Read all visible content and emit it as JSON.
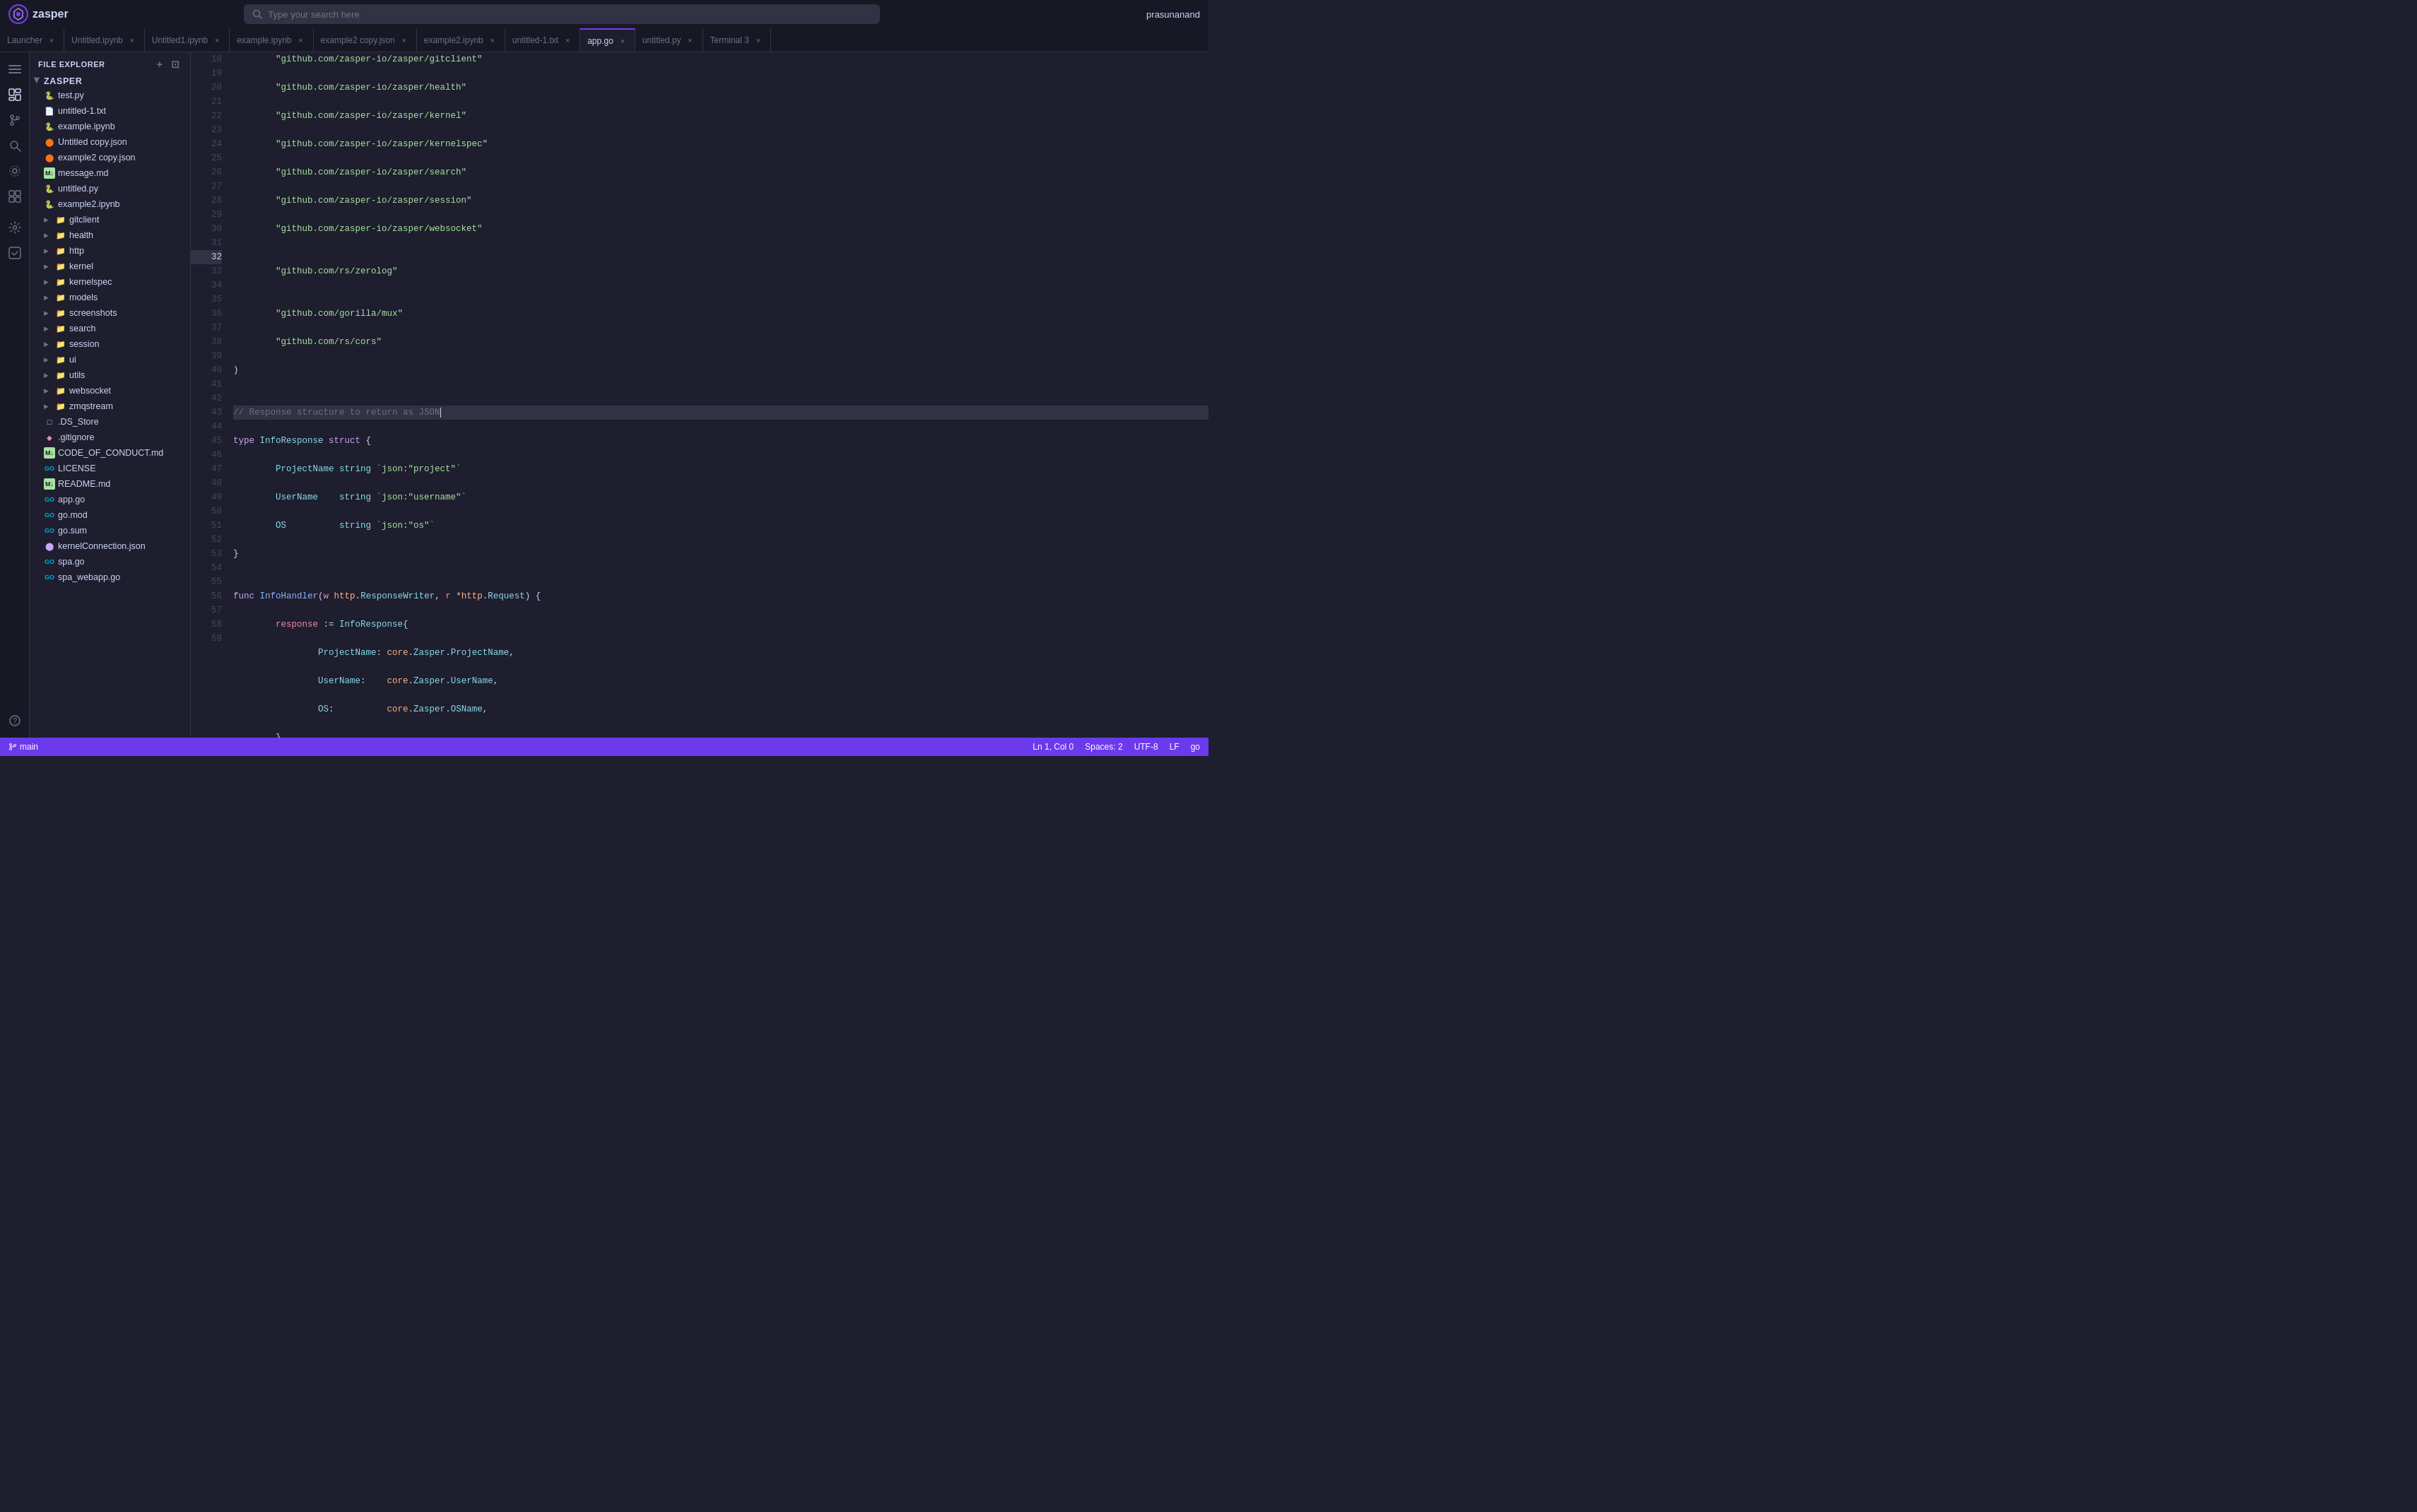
{
  "app": {
    "name": "zasper",
    "logo_alt": "Zasper Logo"
  },
  "topbar": {
    "search_placeholder": "Type your search here",
    "username": "prasunanand"
  },
  "tabs": [
    {
      "label": "Launcher",
      "active": false,
      "closeable": true
    },
    {
      "label": "Untitled.ipynb",
      "active": false,
      "closeable": true
    },
    {
      "label": "Untitled1.ipynb",
      "active": false,
      "closeable": true
    },
    {
      "label": "example.ipynb",
      "active": false,
      "closeable": true
    },
    {
      "label": "example2 copy.json",
      "active": false,
      "closeable": true
    },
    {
      "label": "example2.ipynb",
      "active": false,
      "closeable": true
    },
    {
      "label": "untitled-1.txt",
      "active": false,
      "closeable": true
    },
    {
      "label": "app.go",
      "active": true,
      "closeable": true
    },
    {
      "label": "untitled.py",
      "active": false,
      "closeable": true
    },
    {
      "label": "Terminal 3",
      "active": false,
      "closeable": true
    }
  ],
  "sidebar": {
    "title": "FILE EXPLORER",
    "root": "ZASPER",
    "files": [
      {
        "name": "test.py",
        "type": "py",
        "indent": 1
      },
      {
        "name": "untitled-1.txt",
        "type": "txt",
        "indent": 1
      },
      {
        "name": "example.ipynb",
        "type": "py",
        "indent": 1
      },
      {
        "name": "Untitled copy.json",
        "type": "json",
        "indent": 1
      },
      {
        "name": "example2 copy.json",
        "type": "json",
        "indent": 1
      },
      {
        "name": "message.md",
        "type": "md",
        "indent": 1
      },
      {
        "name": "untitled.py",
        "type": "py",
        "indent": 1
      },
      {
        "name": "example2.ipynb",
        "type": "py",
        "indent": 1
      },
      {
        "name": "gitclient",
        "type": "folder",
        "indent": 1
      },
      {
        "name": "health",
        "type": "folder",
        "indent": 1
      },
      {
        "name": "http",
        "type": "folder",
        "indent": 1
      },
      {
        "name": "kernel",
        "type": "folder",
        "indent": 1
      },
      {
        "name": "kernelspec",
        "type": "folder",
        "indent": 1
      },
      {
        "name": "models",
        "type": "folder",
        "indent": 1
      },
      {
        "name": "screenshots",
        "type": "folder",
        "indent": 1
      },
      {
        "name": "search",
        "type": "folder",
        "indent": 1
      },
      {
        "name": "session",
        "type": "folder",
        "indent": 1
      },
      {
        "name": "ui",
        "type": "folder",
        "indent": 1
      },
      {
        "name": "utils",
        "type": "folder",
        "indent": 1
      },
      {
        "name": "websocket",
        "type": "folder",
        "indent": 1
      },
      {
        "name": "zmqstream",
        "type": "folder",
        "indent": 1
      },
      {
        "name": ".DS_Store",
        "type": "txt",
        "indent": 1
      },
      {
        "name": ".gitignore",
        "type": "git",
        "indent": 1
      },
      {
        "name": "CODE_OF_CONDUCT.md",
        "type": "md",
        "indent": 1
      },
      {
        "name": "LICENSE",
        "type": "go",
        "indent": 1
      },
      {
        "name": "README.md",
        "type": "md",
        "indent": 1
      },
      {
        "name": "app.go",
        "type": "go",
        "indent": 1
      },
      {
        "name": "go.mod",
        "type": "go",
        "indent": 1
      },
      {
        "name": "go.sum",
        "type": "go",
        "indent": 1
      },
      {
        "name": "kernelConnection.json",
        "type": "kernel",
        "indent": 1
      },
      {
        "name": "spa.go",
        "type": "go",
        "indent": 1
      },
      {
        "name": "spa_webapp.go",
        "type": "go",
        "indent": 1
      }
    ]
  },
  "editor": {
    "filename": "app.go",
    "active_line": 32
  },
  "statusbar": {
    "branch": "main",
    "position": "Ln 1, Col 0",
    "spaces": "Spaces: 2",
    "encoding": "UTF-8",
    "eol": "LF",
    "language": "go"
  }
}
